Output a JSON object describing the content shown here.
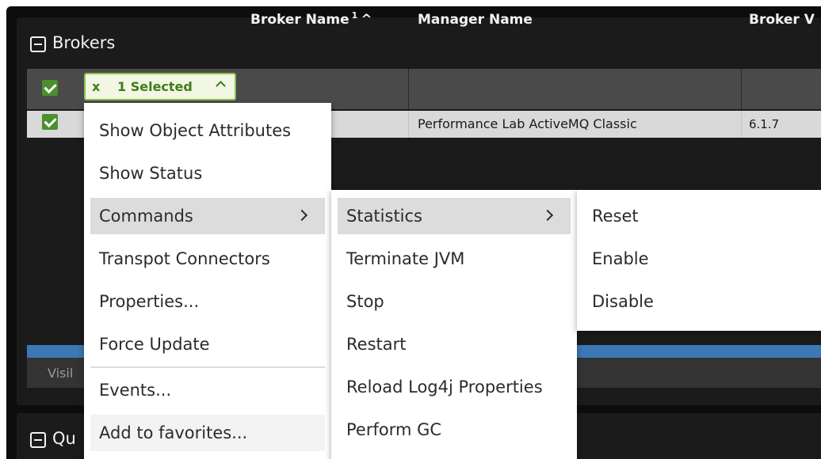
{
  "brokers_panel": {
    "title": "Brokers"
  },
  "queues_panel": {
    "title": "Qu"
  },
  "grid": {
    "columns": [
      {
        "label": "Broker Name",
        "sort_index": "1",
        "sort_arrow": "^"
      },
      {
        "label": "Manager Name"
      },
      {
        "label": "Broker V"
      }
    ],
    "selection_badge": {
      "icon": "x",
      "label": "1 Selected",
      "toggle": "^"
    },
    "rows": [
      {
        "manager_name": "Performance Lab ActiveMQ Classic",
        "broker_version": "6.1.7"
      }
    ],
    "visible_label": "Visil"
  },
  "context_menu": {
    "items": [
      "Show Object Attributes",
      "Show Status",
      "Commands",
      "Transpot Connectors",
      "Properties...",
      "Force Update",
      "Events...",
      "Add to favorites..."
    ]
  },
  "commands_submenu": {
    "items": [
      "Statistics",
      "Terminate JVM",
      "Stop",
      "Restart",
      "Reload Log4j Properties",
      "Perform GC"
    ]
  },
  "statistics_submenu": {
    "items": [
      "Reset",
      "Enable",
      "Disable"
    ]
  },
  "colors": {
    "selection_green": "#4b8f2e",
    "badge_border": "#8bc34a",
    "progress_blue": "#3c78b5",
    "header_bg": "#4a4a4a"
  }
}
